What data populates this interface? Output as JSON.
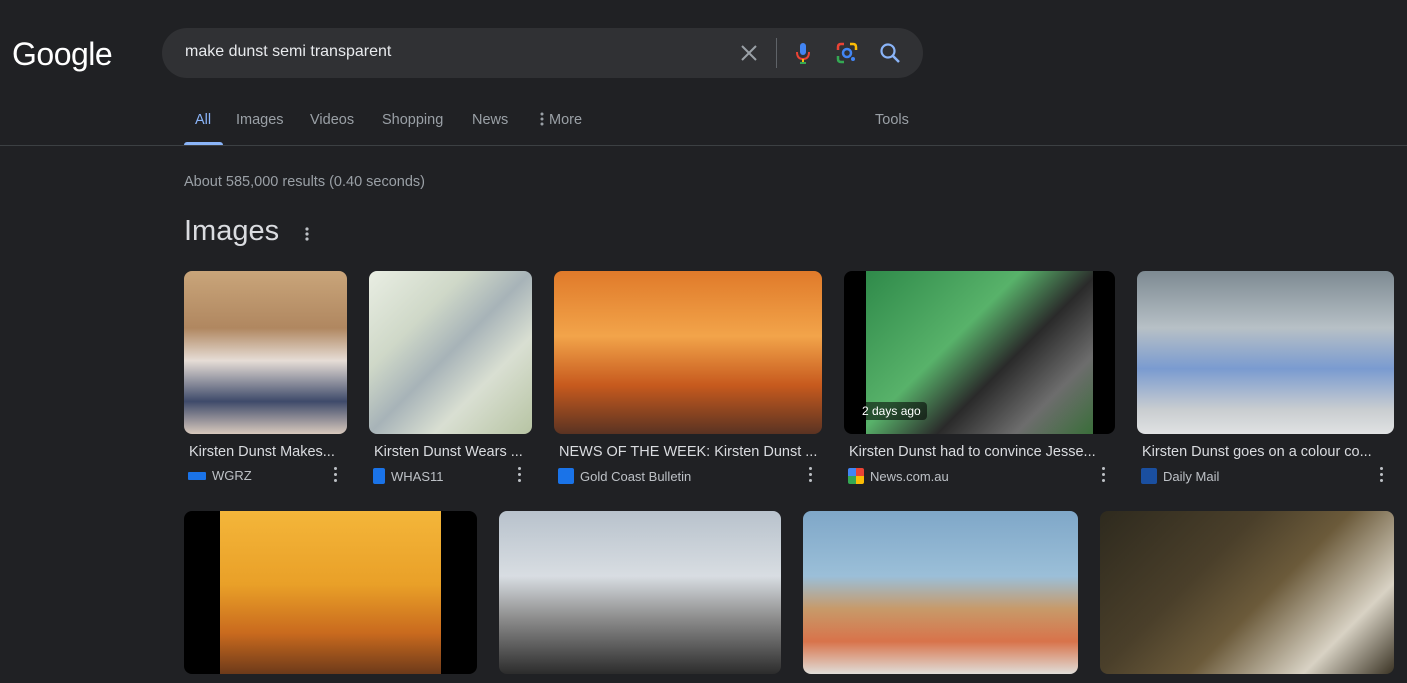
{
  "logo": {
    "text": "Google"
  },
  "search": {
    "query": "make dunst semi transparent"
  },
  "tabs": [
    {
      "label": "All"
    },
    {
      "label": "Images"
    },
    {
      "label": "Videos"
    },
    {
      "label": "Shopping"
    },
    {
      "label": "News"
    },
    {
      "label": "More"
    },
    {
      "label": "Tools"
    }
  ],
  "stats": "About 585,000 results (0.40 seconds)",
  "images_section": {
    "title": "Images"
  },
  "image_results": [
    {
      "caption": "Kirsten Dunst Makes...",
      "source": "WGRZ",
      "icon": "wgrz-favicon"
    },
    {
      "caption": "Kirsten Dunst Wears ...",
      "source": "WHAS11",
      "icon": "whas11-favicon"
    },
    {
      "caption": "NEWS OF THE WEEK: Kirsten Dunst ...",
      "source": "Gold Coast Bulletin",
      "icon": "gcb-favicon"
    },
    {
      "caption": "Kirsten Dunst had to convince Jesse...",
      "source": "News.com.au",
      "icon": "newscomau-favicon",
      "badge": "2 days ago"
    },
    {
      "caption": "Kirsten Dunst goes on a colour co...",
      "source": "Daily Mail",
      "icon": "dailymail-favicon"
    }
  ],
  "colors": {
    "background": "#202124",
    "accent": "#8ab4f8",
    "searchbox": "#303134"
  }
}
